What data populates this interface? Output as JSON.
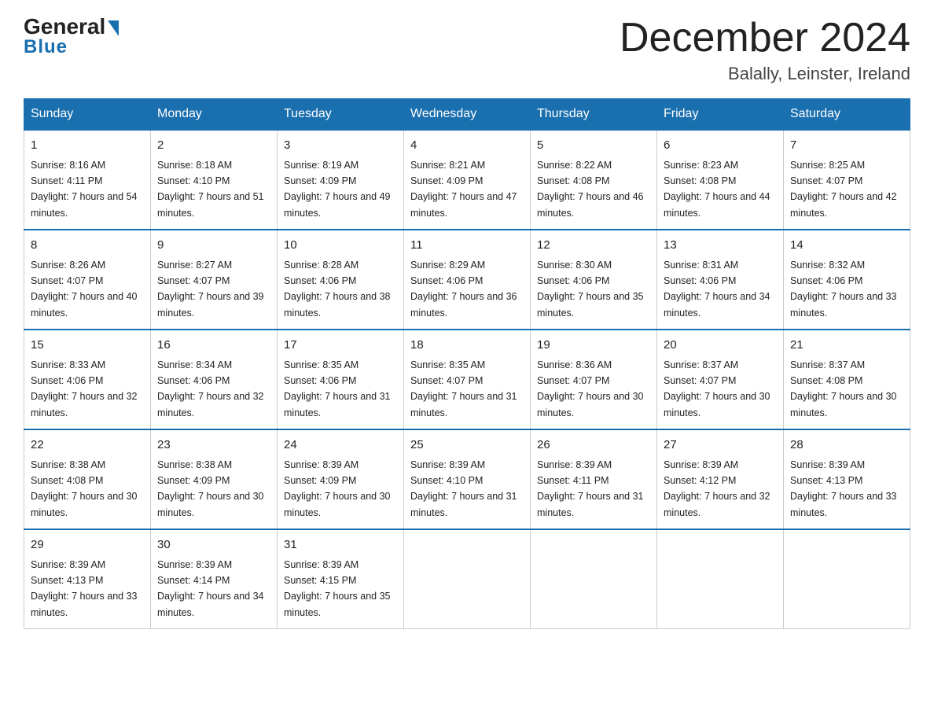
{
  "header": {
    "logo_main": "General",
    "logo_sub": "Blue",
    "month_title": "December 2024",
    "location": "Balally, Leinster, Ireland"
  },
  "weekdays": [
    "Sunday",
    "Monday",
    "Tuesday",
    "Wednesday",
    "Thursday",
    "Friday",
    "Saturday"
  ],
  "weeks": [
    [
      {
        "day": "1",
        "sunrise": "8:16 AM",
        "sunset": "4:11 PM",
        "daylight": "7 hours and 54 minutes."
      },
      {
        "day": "2",
        "sunrise": "8:18 AM",
        "sunset": "4:10 PM",
        "daylight": "7 hours and 51 minutes."
      },
      {
        "day": "3",
        "sunrise": "8:19 AM",
        "sunset": "4:09 PM",
        "daylight": "7 hours and 49 minutes."
      },
      {
        "day": "4",
        "sunrise": "8:21 AM",
        "sunset": "4:09 PM",
        "daylight": "7 hours and 47 minutes."
      },
      {
        "day": "5",
        "sunrise": "8:22 AM",
        "sunset": "4:08 PM",
        "daylight": "7 hours and 46 minutes."
      },
      {
        "day": "6",
        "sunrise": "8:23 AM",
        "sunset": "4:08 PM",
        "daylight": "7 hours and 44 minutes."
      },
      {
        "day": "7",
        "sunrise": "8:25 AM",
        "sunset": "4:07 PM",
        "daylight": "7 hours and 42 minutes."
      }
    ],
    [
      {
        "day": "8",
        "sunrise": "8:26 AM",
        "sunset": "4:07 PM",
        "daylight": "7 hours and 40 minutes."
      },
      {
        "day": "9",
        "sunrise": "8:27 AM",
        "sunset": "4:07 PM",
        "daylight": "7 hours and 39 minutes."
      },
      {
        "day": "10",
        "sunrise": "8:28 AM",
        "sunset": "4:06 PM",
        "daylight": "7 hours and 38 minutes."
      },
      {
        "day": "11",
        "sunrise": "8:29 AM",
        "sunset": "4:06 PM",
        "daylight": "7 hours and 36 minutes."
      },
      {
        "day": "12",
        "sunrise": "8:30 AM",
        "sunset": "4:06 PM",
        "daylight": "7 hours and 35 minutes."
      },
      {
        "day": "13",
        "sunrise": "8:31 AM",
        "sunset": "4:06 PM",
        "daylight": "7 hours and 34 minutes."
      },
      {
        "day": "14",
        "sunrise": "8:32 AM",
        "sunset": "4:06 PM",
        "daylight": "7 hours and 33 minutes."
      }
    ],
    [
      {
        "day": "15",
        "sunrise": "8:33 AM",
        "sunset": "4:06 PM",
        "daylight": "7 hours and 32 minutes."
      },
      {
        "day": "16",
        "sunrise": "8:34 AM",
        "sunset": "4:06 PM",
        "daylight": "7 hours and 32 minutes."
      },
      {
        "day": "17",
        "sunrise": "8:35 AM",
        "sunset": "4:06 PM",
        "daylight": "7 hours and 31 minutes."
      },
      {
        "day": "18",
        "sunrise": "8:35 AM",
        "sunset": "4:07 PM",
        "daylight": "7 hours and 31 minutes."
      },
      {
        "day": "19",
        "sunrise": "8:36 AM",
        "sunset": "4:07 PM",
        "daylight": "7 hours and 30 minutes."
      },
      {
        "day": "20",
        "sunrise": "8:37 AM",
        "sunset": "4:07 PM",
        "daylight": "7 hours and 30 minutes."
      },
      {
        "day": "21",
        "sunrise": "8:37 AM",
        "sunset": "4:08 PM",
        "daylight": "7 hours and 30 minutes."
      }
    ],
    [
      {
        "day": "22",
        "sunrise": "8:38 AM",
        "sunset": "4:08 PM",
        "daylight": "7 hours and 30 minutes."
      },
      {
        "day": "23",
        "sunrise": "8:38 AM",
        "sunset": "4:09 PM",
        "daylight": "7 hours and 30 minutes."
      },
      {
        "day": "24",
        "sunrise": "8:39 AM",
        "sunset": "4:09 PM",
        "daylight": "7 hours and 30 minutes."
      },
      {
        "day": "25",
        "sunrise": "8:39 AM",
        "sunset": "4:10 PM",
        "daylight": "7 hours and 31 minutes."
      },
      {
        "day": "26",
        "sunrise": "8:39 AM",
        "sunset": "4:11 PM",
        "daylight": "7 hours and 31 minutes."
      },
      {
        "day": "27",
        "sunrise": "8:39 AM",
        "sunset": "4:12 PM",
        "daylight": "7 hours and 32 minutes."
      },
      {
        "day": "28",
        "sunrise": "8:39 AM",
        "sunset": "4:13 PM",
        "daylight": "7 hours and 33 minutes."
      }
    ],
    [
      {
        "day": "29",
        "sunrise": "8:39 AM",
        "sunset": "4:13 PM",
        "daylight": "7 hours and 33 minutes."
      },
      {
        "day": "30",
        "sunrise": "8:39 AM",
        "sunset": "4:14 PM",
        "daylight": "7 hours and 34 minutes."
      },
      {
        "day": "31",
        "sunrise": "8:39 AM",
        "sunset": "4:15 PM",
        "daylight": "7 hours and 35 minutes."
      },
      null,
      null,
      null,
      null
    ]
  ]
}
